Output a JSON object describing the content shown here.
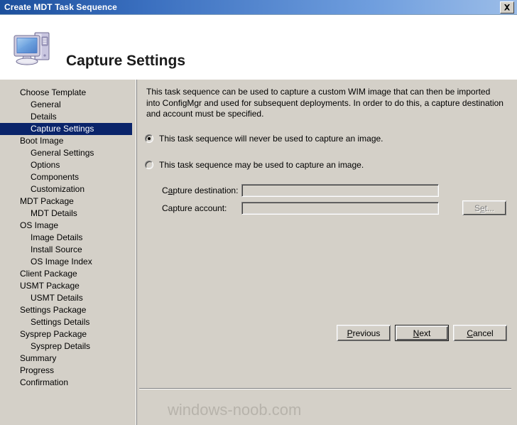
{
  "window": {
    "title": "Create MDT Task Sequence",
    "close_icon": "close-icon"
  },
  "header": {
    "title": "Capture Settings",
    "icon": "computer-icon"
  },
  "sidebar": {
    "items": [
      {
        "label": "Choose Template",
        "level": 0,
        "selected": false
      },
      {
        "label": "General",
        "level": 1,
        "selected": false
      },
      {
        "label": "Details",
        "level": 1,
        "selected": false
      },
      {
        "label": "Capture Settings",
        "level": 1,
        "selected": true
      },
      {
        "label": "Boot Image",
        "level": 0,
        "selected": false
      },
      {
        "label": "General Settings",
        "level": 1,
        "selected": false
      },
      {
        "label": "Options",
        "level": 1,
        "selected": false
      },
      {
        "label": "Components",
        "level": 1,
        "selected": false
      },
      {
        "label": "Customization",
        "level": 1,
        "selected": false
      },
      {
        "label": "MDT Package",
        "level": 0,
        "selected": false
      },
      {
        "label": "MDT Details",
        "level": 1,
        "selected": false
      },
      {
        "label": "OS Image",
        "level": 0,
        "selected": false
      },
      {
        "label": "Image Details",
        "level": 1,
        "selected": false
      },
      {
        "label": "Install Source",
        "level": 1,
        "selected": false
      },
      {
        "label": "OS Image Index",
        "level": 1,
        "selected": false
      },
      {
        "label": "Client Package",
        "level": 0,
        "selected": false
      },
      {
        "label": "USMT Package",
        "level": 0,
        "selected": false
      },
      {
        "label": "USMT Details",
        "level": 1,
        "selected": false
      },
      {
        "label": "Settings Package",
        "level": 0,
        "selected": false
      },
      {
        "label": "Settings Details",
        "level": 1,
        "selected": false
      },
      {
        "label": "Sysprep Package",
        "level": 0,
        "selected": false
      },
      {
        "label": "Sysprep Details",
        "level": 1,
        "selected": false
      },
      {
        "label": "Summary",
        "level": 0,
        "selected": false
      },
      {
        "label": "Progress",
        "level": 0,
        "selected": false
      },
      {
        "label": "Confirmation",
        "level": 0,
        "selected": false
      }
    ]
  },
  "content": {
    "description": "This task sequence can be used to capture a custom WIM image that can then be imported into ConfigMgr and used for subsequent deployments.  In order to do this, a capture destination and account must be specified.",
    "radio_never": {
      "label": "This task sequence will never be used to capture an image.",
      "checked": true
    },
    "radio_may": {
      "label": "This task sequence may be used to capture an image.",
      "checked": false
    },
    "capture_destination": {
      "label": "Capture destination:",
      "value": "",
      "enabled": false
    },
    "capture_account": {
      "label": "Capture account:",
      "value": "",
      "enabled": false
    },
    "set_button": {
      "label": "Set...",
      "enabled": false
    }
  },
  "footer": {
    "watermark": "windows-noob.com",
    "previous": "Previous",
    "next": "Next",
    "cancel": "Cancel"
  }
}
